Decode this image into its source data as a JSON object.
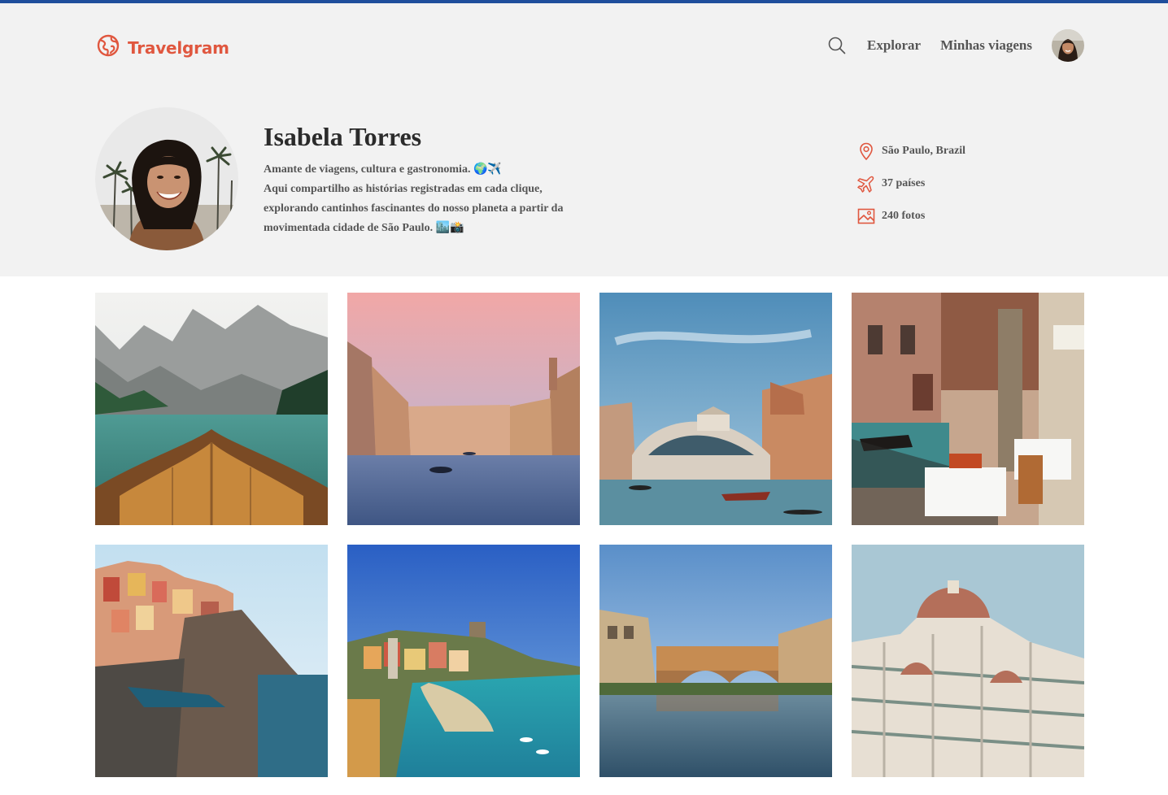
{
  "app": {
    "name": "Travelgram",
    "brand_color": "#e0573f",
    "top_strip_color": "#1f4e9c"
  },
  "nav": {
    "search_icon": "search-icon",
    "links": [
      {
        "label": "Explorar"
      },
      {
        "label": "Minhas viagens"
      }
    ]
  },
  "profile": {
    "name": "Isabela Torres",
    "bio_lines": [
      "Amante de viagens, cultura e gastronomia. 🌍✈️",
      "Aqui compartilho as histórias registradas em cada clique,",
      "explorando cantinhos fascinantes do nosso planeta a partir da",
      "movimentada cidade de São Paulo. 🏙️📸"
    ],
    "stats": [
      {
        "icon": "map-pin-icon",
        "label": "São Paulo, Brazil"
      },
      {
        "icon": "airplane-icon",
        "label": "37 países"
      },
      {
        "icon": "image-icon",
        "label": "240 fotos"
      }
    ]
  },
  "photos": [
    {
      "subject": "boat-lake-mountains"
    },
    {
      "subject": "venice-canal-sunset"
    },
    {
      "subject": "rialto-bridge"
    },
    {
      "subject": "venice-restaurant-canal"
    },
    {
      "subject": "manarola-cliff"
    },
    {
      "subject": "vernazza-harbor"
    },
    {
      "subject": "ponte-vecchio"
    },
    {
      "subject": "florence-duomo"
    }
  ]
}
